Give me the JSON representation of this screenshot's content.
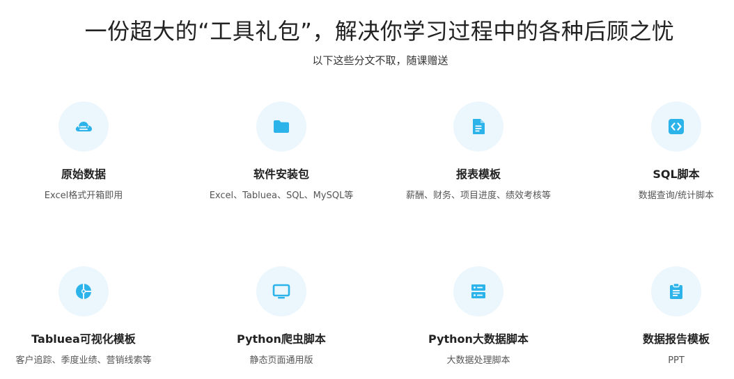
{
  "header": {
    "title": "一份超大的“工具礼包”，解决你学习过程中的各种后顾之忧",
    "subtitle": "以下这些分文不取，随课赠送"
  },
  "accent_color": "#2bb3ea",
  "items": [
    {
      "title": "原始数据",
      "desc": "Excel格式开箱即用",
      "icon": "cloud-icon"
    },
    {
      "title": "软件安装包",
      "desc": "Excel、Tabluea、SQL、MySQL等",
      "icon": "folder-icon"
    },
    {
      "title": "报表模板",
      "desc": "薪酬、财务、项目进度、绩效考核等",
      "icon": "document-icon"
    },
    {
      "title": "SQL脚本",
      "desc": "数据查询/统计脚本",
      "icon": "code-icon"
    },
    {
      "title": "Tabluea可视化模板",
      "desc": "客户追踪、季度业绩、营销线索等",
      "icon": "pie-chart-icon"
    },
    {
      "title": "Python爬虫脚本",
      "desc": "静态页面通用版",
      "icon": "monitor-icon"
    },
    {
      "title": "Python大数据脚本",
      "desc": "大数据处理脚本",
      "icon": "server-icon"
    },
    {
      "title": "数据报告模板",
      "desc": "PPT",
      "icon": "clipboard-icon"
    }
  ]
}
